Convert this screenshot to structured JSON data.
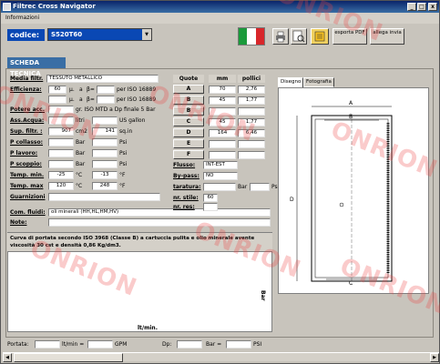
{
  "window": {
    "title": "Filtrec Cross Navigator",
    "min": "_",
    "max": "□",
    "close": "x"
  },
  "menu": {
    "items": [
      "Informazioni"
    ]
  },
  "codice": {
    "label": "codice:",
    "value": "S520T60"
  },
  "toolbar": {
    "esporta": "esporta PDF",
    "allega": "allega invia"
  },
  "section": {
    "title": "SCHEDA TECNICA"
  },
  "left": {
    "media_label": "Media filtr.",
    "media_value": "TESSUTO METALLICO",
    "eff_label": "Efficienza:",
    "eff_v1": "60",
    "eff_mu": "µ.",
    "eff_a": "a",
    "eff_beta": "β=",
    "eff_iso": "per ISO 16889",
    "eff_v2": "",
    "eff_mu2": "µ.",
    "eff_a2": "a",
    "eff_beta2": "β=",
    "eff_iso2": "per ISO 16889",
    "potere_label": "Potere acc.",
    "potere_text": "gr. ISO MTD a Dp finale 5 Bar",
    "ass_label": "Ass.Acqua:",
    "ass_litri": "litri",
    "ass_gal": "US gallon",
    "sup_label": "Sup. filtr. :",
    "sup_v1": "907",
    "sup_cm2": "cm2",
    "sup_v2": "141",
    "sup_sqin": "sq.in",
    "pcoll_label": "P collasso:",
    "pcoll_bar": "Bar",
    "pcoll_psi": "Psi",
    "plav_label": "P lavoro:",
    "plav_bar": "Bar",
    "plav_psi": "Psi",
    "pscop_label": "P scoppio:",
    "pscop_bar": "Bar",
    "pscop_psi": "Psi",
    "tmin_label": "Temp. min.",
    "tmin_c": "-25",
    "tmin_cu": "°C",
    "tmin_f": "-13",
    "tmin_fu": "°F",
    "tmax_label": "Temp. max",
    "tmax_c": "120",
    "tmax_cu": "°C",
    "tmax_f": "248",
    "tmax_fu": "°F",
    "guarn_label": "Guarnizioni",
    "comp_label": "Com. fluidi:",
    "comp_value": "oli minerali (HH,HL,HM,HV)",
    "note_label": "Note:"
  },
  "quote": {
    "hdr_quote": "Quote",
    "hdr_mm": "mm",
    "hdr_pollici": "pollici",
    "rows": [
      {
        "q": "A",
        "mm": "70",
        "in": "2,76"
      },
      {
        "q": "B",
        "mm": "45",
        "in": "1,77"
      },
      {
        "q": "B",
        "mm": "",
        "in": ""
      },
      {
        "q": "C",
        "mm": "45",
        "in": "1,77"
      },
      {
        "q": "D",
        "mm": "164",
        "in": "6,46"
      },
      {
        "q": "E",
        "mm": "",
        "in": ""
      },
      {
        "q": "F",
        "mm": "",
        "in": ""
      }
    ],
    "flusso_label": "Flusso:",
    "flusso_value": "INT-EST",
    "bypass_label": "By-pass:",
    "bypass_value": "NO",
    "taratura_label": "taratura:",
    "taratura_bar": "Bar",
    "taratura_psi": "Psi",
    "stile_label": "nr. stile:",
    "stile_value": "60",
    "res_label": "nr. res:"
  },
  "tabs": [
    "Disegno",
    "Fotografia"
  ],
  "drawing": {
    "A": "A",
    "B": "B",
    "C": "C",
    "D": "D"
  },
  "curve": {
    "text": "Curva di portata secondo ISO 3968 (Classe B) a cartuccia pulita e olio minerale avente viscosità 30 cst e densità 0,86 Kg/dm3.",
    "yunit": "Bar",
    "xunit": "lt/min."
  },
  "status": {
    "portata_label": "Portata:",
    "ltmin": "lt/min =",
    "gpm": "GPM",
    "dp_label": "Dp:",
    "bar": "Bar =",
    "psi": "PSI"
  },
  "watermark": "ONRION",
  "colors": {
    "titlebar": "#0a246a",
    "codice_bg": "#0a48b4",
    "section_bg": "#3a6ea5",
    "watermark": "#ee4646"
  }
}
